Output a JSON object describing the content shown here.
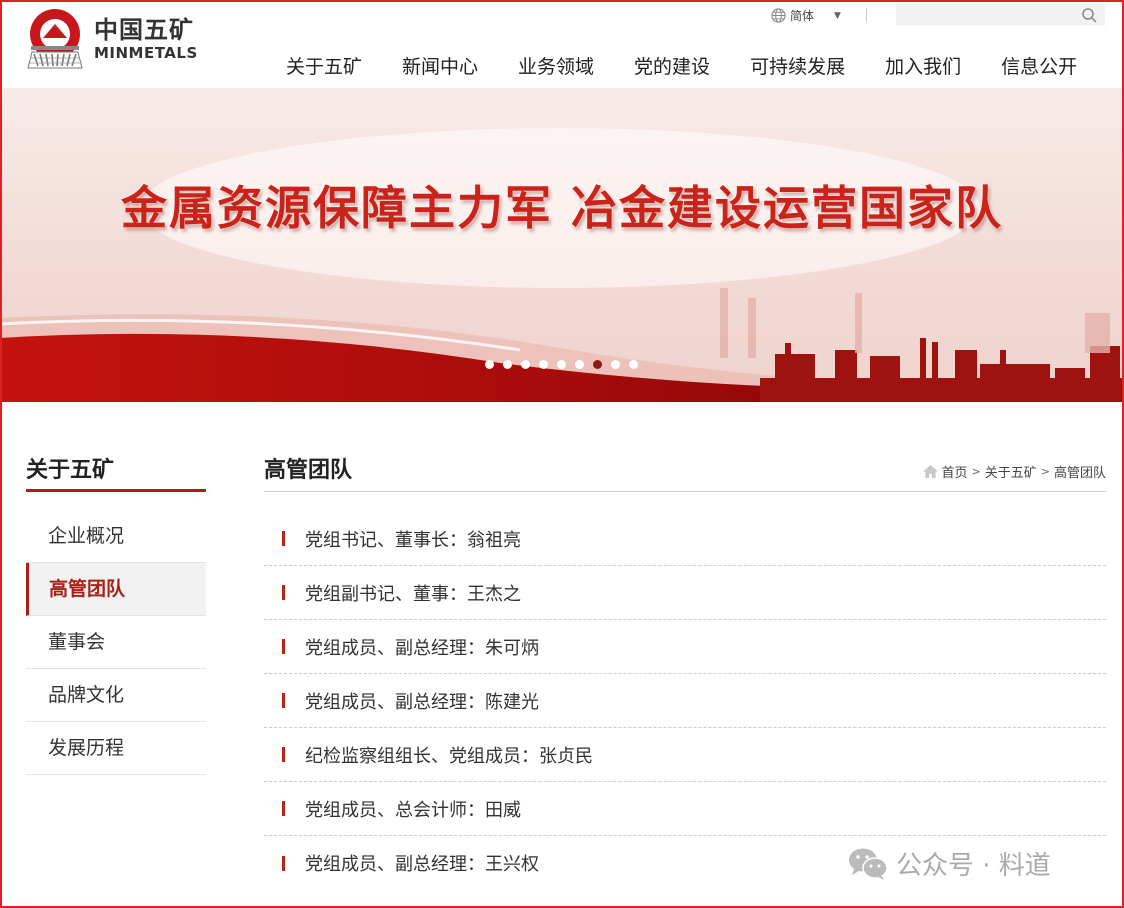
{
  "brand": {
    "name_cn": "中国五矿",
    "name_en": "MINMETALS",
    "logo_ring_text": "MINMETALS",
    "color": "#c8161d"
  },
  "topbar": {
    "language": "简体",
    "search_placeholder": ""
  },
  "nav": {
    "items": [
      "关于五矿",
      "新闻中心",
      "业务领域",
      "党的建设",
      "可持续发展",
      "加入我们",
      "信息公开"
    ]
  },
  "banner": {
    "slogan": "金属资源保障主力军  冶金建设运营国家队",
    "slide_count": 9,
    "active_slide": 7
  },
  "sidebar": {
    "title": "关于五矿",
    "items": [
      {
        "label": "企业概况",
        "active": false
      },
      {
        "label": "高管团队",
        "active": true
      },
      {
        "label": "董事会",
        "active": false
      },
      {
        "label": "品牌文化",
        "active": false
      },
      {
        "label": "发展历程",
        "active": false
      }
    ]
  },
  "main": {
    "title": "高管团队",
    "breadcrumb": [
      "首页",
      "关于五矿",
      "高管团队"
    ],
    "breadcrumb_sep": ">",
    "list": [
      "党组书记、董事长：翁祖亮",
      "党组副书记、董事：王杰之",
      "党组成员、副总经理：朱可炳",
      "党组成员、副总经理：陈建光",
      "纪检监察组组长、党组成员：张贞民",
      "党组成员、总会计师：田威",
      "党组成员、副总经理：王兴权"
    ]
  },
  "watermark": {
    "text": "公众号 · 料道"
  }
}
